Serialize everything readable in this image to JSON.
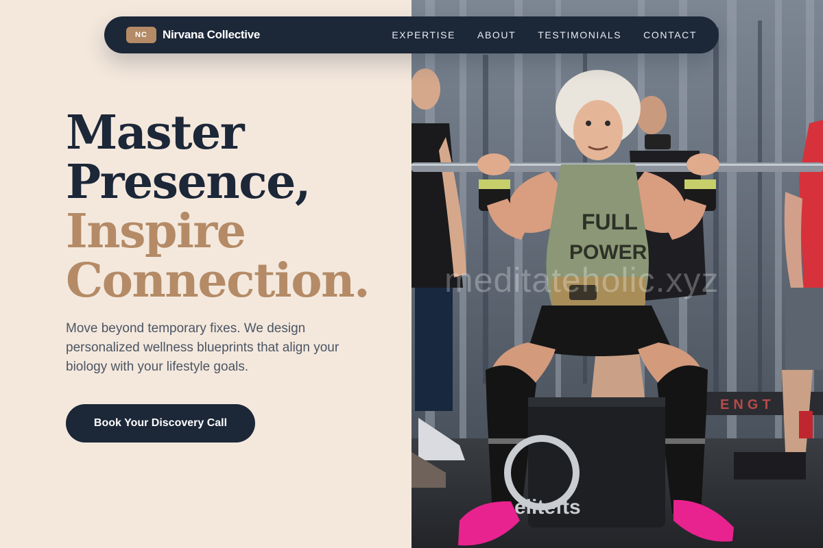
{
  "brand": {
    "badge": "NC",
    "name": "Nirvana Collective"
  },
  "nav": {
    "links": [
      "EXPERTISE",
      "ABOUT",
      "TESTIMONIALS",
      "CONTACT"
    ]
  },
  "hero": {
    "title_line1": "Master",
    "title_line2": "Presence,",
    "title_line3": "Inspire",
    "title_line4": "Connection.",
    "description": "Move beyond temporary fixes. We design personalized wellness blueprints that align your biology with your lifestyle goals.",
    "cta_label": "Book Your Discovery Call"
  },
  "photo": {
    "shirt_text_1": "FULL",
    "shirt_text_2": "POWER",
    "box_text": "elitefts",
    "watermark": "meditateholic.xyz"
  },
  "colors": {
    "navy": "#1c2738",
    "accent": "#b48b66",
    "background": "#f4e8dd",
    "body_text": "#4b5563",
    "pink": "#e8228f"
  }
}
